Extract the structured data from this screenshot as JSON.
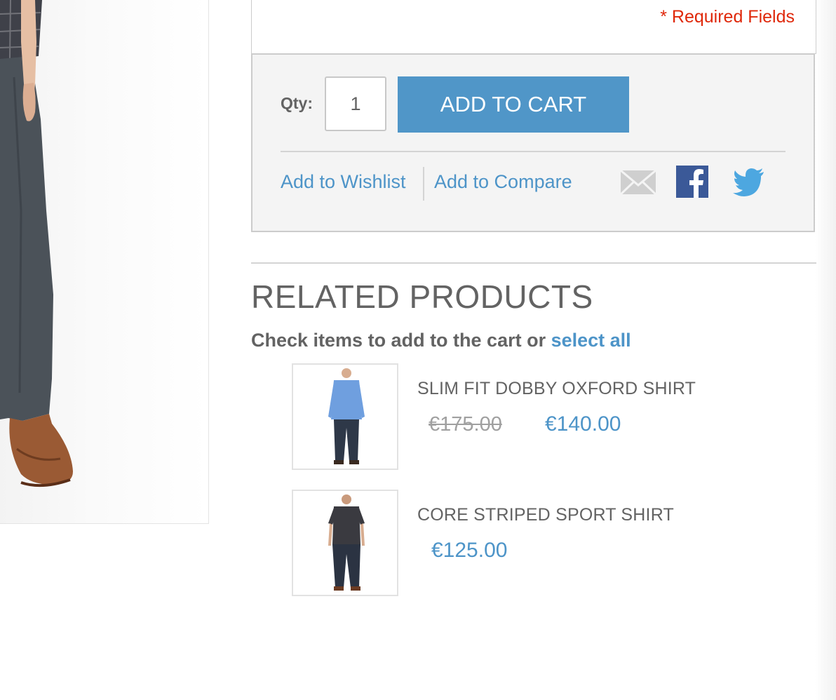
{
  "form": {
    "required_fields": "* Required Fields"
  },
  "cart": {
    "qty_label": "Qty:",
    "qty_value": "1",
    "add_to_cart_label": "ADD TO CART",
    "wishlist_label": "Add to Wishlist",
    "compare_label": "Add to Compare"
  },
  "share": {
    "icons": [
      "email-icon",
      "facebook-icon",
      "twitter-icon"
    ]
  },
  "related": {
    "title": "RELATED PRODUCTS",
    "instruction": "Check items to add to the cart or",
    "select_all_label": "select all",
    "items": [
      {
        "name": "SLIM FIT DOBBY OXFORD SHIRT",
        "old_price": "€175.00",
        "price": "€140.00",
        "shirt_color": "#6f9fdf"
      },
      {
        "name": "CORE STRIPED SPORT SHIRT",
        "price": "€125.00",
        "shirt_color": "#3a3a40"
      }
    ]
  },
  "colors": {
    "link": "#4d94c8",
    "button": "#5096c8",
    "required": "#df280a",
    "text": "#636363"
  }
}
